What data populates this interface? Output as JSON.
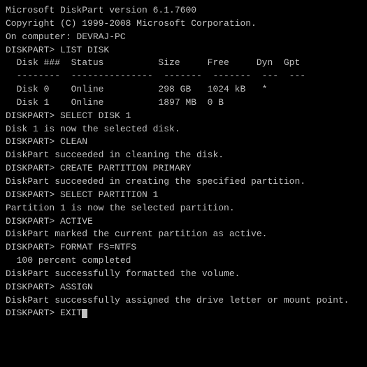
{
  "terminal": {
    "lines": [
      {
        "id": "version-line",
        "text": "Microsoft DiskPart version 6.1.7600"
      },
      {
        "id": "copyright-line",
        "text": "Copyright (C) 1999-2008 Microsoft Corporation."
      },
      {
        "id": "computer-line",
        "text": "On computer: DEVRAJ-PC"
      },
      {
        "id": "blank1",
        "text": ""
      },
      {
        "id": "list-disk-cmd",
        "text": "DISKPART> LIST DISK"
      },
      {
        "id": "blank2",
        "text": ""
      },
      {
        "id": "disk-header",
        "text": "  Disk ###  Status          Size     Free     Dyn  Gpt"
      },
      {
        "id": "disk-divider",
        "text": "  --------  ---------------  -------  -------  ---  ---"
      },
      {
        "id": "disk0",
        "text": "  Disk 0    Online          298 GB   1024 kB   *"
      },
      {
        "id": "disk1",
        "text": "  Disk 1    Online          1897 MB  0 B"
      },
      {
        "id": "blank3",
        "text": ""
      },
      {
        "id": "select-disk-cmd",
        "text": "DISKPART> SELECT DISK 1"
      },
      {
        "id": "blank4",
        "text": ""
      },
      {
        "id": "select-disk-result",
        "text": "Disk 1 is now the selected disk."
      },
      {
        "id": "blank5",
        "text": ""
      },
      {
        "id": "clean-cmd",
        "text": "DISKPART> CLEAN"
      },
      {
        "id": "blank6",
        "text": ""
      },
      {
        "id": "clean-result",
        "text": "DiskPart succeeded in cleaning the disk."
      },
      {
        "id": "create-cmd",
        "text": "DISKPART> CREATE PARTITION PRIMARY"
      },
      {
        "id": "blank7",
        "text": ""
      },
      {
        "id": "create-result",
        "text": "DiskPart succeeded in creating the specified partition."
      },
      {
        "id": "blank8",
        "text": ""
      },
      {
        "id": "select-part-cmd",
        "text": "DISKPART> SELECT PARTITION 1"
      },
      {
        "id": "blank9",
        "text": ""
      },
      {
        "id": "select-part-result",
        "text": "Partition 1 is now the selected partition."
      },
      {
        "id": "blank10",
        "text": ""
      },
      {
        "id": "active-cmd",
        "text": "DISKPART> ACTIVE"
      },
      {
        "id": "blank11",
        "text": ""
      },
      {
        "id": "active-result",
        "text": "DiskPart marked the current partition as active."
      },
      {
        "id": "blank12",
        "text": ""
      },
      {
        "id": "format-cmd",
        "text": "DISKPART> FORMAT FS=NTFS"
      },
      {
        "id": "blank13",
        "text": ""
      },
      {
        "id": "format-progress",
        "text": "  100 percent completed"
      },
      {
        "id": "blank14",
        "text": ""
      },
      {
        "id": "format-result",
        "text": "DiskPart successfully formatted the volume."
      },
      {
        "id": "blank15",
        "text": ""
      },
      {
        "id": "assign-cmd",
        "text": "DISKPART> ASSIGN"
      },
      {
        "id": "blank16",
        "text": ""
      },
      {
        "id": "assign-result",
        "text": "DiskPart successfully assigned the drive letter or mount point."
      },
      {
        "id": "blank17",
        "text": ""
      },
      {
        "id": "exit-cmd",
        "text": "DISKPART> EXIT"
      }
    ]
  }
}
